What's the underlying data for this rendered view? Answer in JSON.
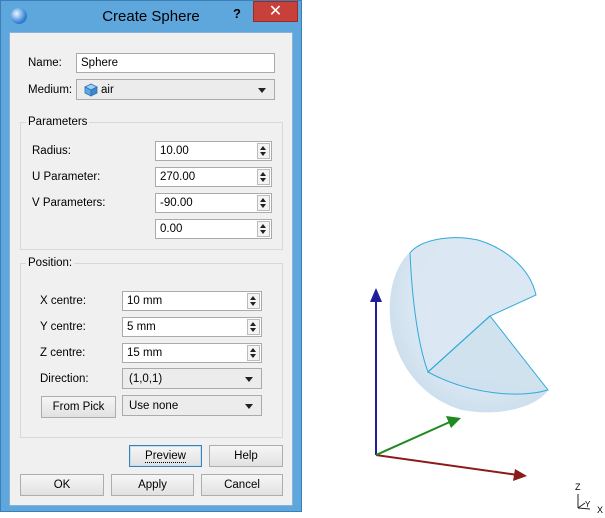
{
  "dialog": {
    "title": "Create Sphere",
    "help_glyph": "?",
    "close_glyph": "✕"
  },
  "form": {
    "name_label": "Name:",
    "name_value": "Sphere",
    "medium_label": "Medium:",
    "medium_value": "air"
  },
  "parameters": {
    "title": "Parameters",
    "radius_label": "Radius:",
    "radius_value": "10.00",
    "u_label": "U Parameter:",
    "u_value": "270.00",
    "v_label": "V Parameters:",
    "v_value1": "-90.00",
    "v_value2": "0.00"
  },
  "position": {
    "title": "Position:",
    "x_label": "X centre:",
    "x_value": "10 mm",
    "y_label": "Y centre:",
    "y_value": "5 mm",
    "z_label": "Z centre:",
    "z_value": "15 mm",
    "direction_label": "Direction:",
    "direction_value": "(1,0,1)",
    "from_pick_label": "From Pick",
    "pick_mode_value": "Use none"
  },
  "buttons": {
    "preview": "Preview",
    "help": "Help",
    "ok": "OK",
    "apply": "Apply",
    "cancel": "Cancel"
  },
  "viewport": {
    "triad_z": "Z",
    "triad_y": "Y",
    "triad_x": "X",
    "colors": {
      "sphere_fill": "#d7e6f2",
      "wedge_edge": "#2aa7d8",
      "axis_x": "#8b1a1a",
      "axis_y": "#1f8a1f",
      "axis_z": "#1f1f9a"
    }
  }
}
